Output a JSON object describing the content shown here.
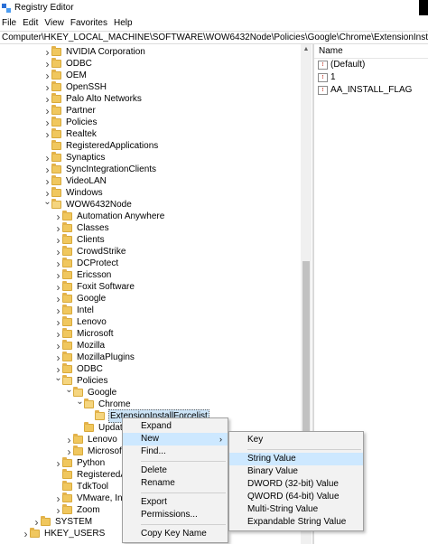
{
  "window": {
    "title": "Registry Editor"
  },
  "menu": [
    "File",
    "Edit",
    "View",
    "Favorites",
    "Help"
  ],
  "address": "Computer\\HKEY_LOCAL_MACHINE\\SOFTWARE\\WOW6432Node\\Policies\\Google\\Chrome\\ExtensionInstallForcelist",
  "tree": [
    {
      "label": "NVIDIA Corporation",
      "level": 1,
      "state": "collapsed"
    },
    {
      "label": "ODBC",
      "level": 1,
      "state": "collapsed"
    },
    {
      "label": "OEM",
      "level": 1,
      "state": "collapsed"
    },
    {
      "label": "OpenSSH",
      "level": 1,
      "state": "collapsed"
    },
    {
      "label": "Palo Alto Networks",
      "level": 1,
      "state": "collapsed"
    },
    {
      "label": "Partner",
      "level": 1,
      "state": "collapsed"
    },
    {
      "label": "Policies",
      "level": 1,
      "state": "collapsed"
    },
    {
      "label": "Realtek",
      "level": 1,
      "state": "collapsed"
    },
    {
      "label": "RegisteredApplications",
      "level": 1,
      "state": "leaf"
    },
    {
      "label": "Synaptics",
      "level": 1,
      "state": "collapsed"
    },
    {
      "label": "SyncIntegrationClients",
      "level": 1,
      "state": "collapsed"
    },
    {
      "label": "VideoLAN",
      "level": 1,
      "state": "collapsed"
    },
    {
      "label": "Windows",
      "level": 1,
      "state": "collapsed"
    },
    {
      "label": "WOW6432Node",
      "level": 1,
      "state": "expanded"
    },
    {
      "label": "Automation Anywhere",
      "level": 2,
      "state": "collapsed"
    },
    {
      "label": "Classes",
      "level": 2,
      "state": "collapsed"
    },
    {
      "label": "Clients",
      "level": 2,
      "state": "collapsed"
    },
    {
      "label": "CrowdStrike",
      "level": 2,
      "state": "collapsed"
    },
    {
      "label": "DCProtect",
      "level": 2,
      "state": "collapsed"
    },
    {
      "label": "Ericsson",
      "level": 2,
      "state": "collapsed"
    },
    {
      "label": "Foxit Software",
      "level": 2,
      "state": "collapsed"
    },
    {
      "label": "Google",
      "level": 2,
      "state": "collapsed"
    },
    {
      "label": "Intel",
      "level": 2,
      "state": "collapsed"
    },
    {
      "label": "Lenovo",
      "level": 2,
      "state": "collapsed"
    },
    {
      "label": "Microsoft",
      "level": 2,
      "state": "collapsed"
    },
    {
      "label": "Mozilla",
      "level": 2,
      "state": "collapsed"
    },
    {
      "label": "MozillaPlugins",
      "level": 2,
      "state": "collapsed"
    },
    {
      "label": "ODBC",
      "level": 2,
      "state": "collapsed"
    },
    {
      "label": "Policies",
      "level": 2,
      "state": "expanded"
    },
    {
      "label": "Google",
      "level": 3,
      "state": "expanded"
    },
    {
      "label": "Chrome",
      "level": 4,
      "state": "expanded"
    },
    {
      "label": "ExtensionInstallForcelist",
      "level": 5,
      "state": "selected"
    },
    {
      "label": "Update",
      "level": 4,
      "state": "leaf"
    },
    {
      "label": "Lenovo",
      "level": 3,
      "state": "collapsed"
    },
    {
      "label": "Microsoft",
      "level": 3,
      "state": "collapsed"
    },
    {
      "label": "Python",
      "level": 2,
      "state": "collapsed"
    },
    {
      "label": "RegisteredApp",
      "level": 2,
      "state": "leaf"
    },
    {
      "label": "TdkTool",
      "level": 2,
      "state": "leaf"
    },
    {
      "label": "VMware, Inc.",
      "level": 2,
      "state": "collapsed"
    },
    {
      "label": "Zoom",
      "level": 2,
      "state": "collapsed"
    },
    {
      "label": "SYSTEM",
      "level": 0,
      "state": "collapsed"
    },
    {
      "label": "HKEY_USERS",
      "level": -1,
      "state": "collapsed"
    }
  ],
  "values": {
    "header": "Name",
    "rows": [
      {
        "name": "(Default)",
        "icon": "string-value-icon"
      },
      {
        "name": "1",
        "icon": "string-value-icon"
      },
      {
        "name": "AA_INSTALL_FLAG",
        "icon": "string-value-icon"
      }
    ]
  },
  "context_menu": {
    "items": [
      {
        "label": "Expand",
        "type": "item"
      },
      {
        "label": "New",
        "type": "submenu",
        "highlighted": true
      },
      {
        "label": "Find...",
        "type": "item"
      },
      {
        "type": "separator"
      },
      {
        "label": "Delete",
        "type": "item"
      },
      {
        "label": "Rename",
        "type": "item"
      },
      {
        "type": "separator"
      },
      {
        "label": "Export",
        "type": "item"
      },
      {
        "label": "Permissions...",
        "type": "item"
      },
      {
        "type": "separator"
      },
      {
        "label": "Copy Key Name",
        "type": "item"
      }
    ],
    "submenu_arrow": "›"
  },
  "new_submenu": {
    "items": [
      {
        "label": "Key",
        "type": "item"
      },
      {
        "type": "separator"
      },
      {
        "label": "String Value",
        "type": "item",
        "highlighted": true
      },
      {
        "label": "Binary Value",
        "type": "item"
      },
      {
        "label": "DWORD (32-bit) Value",
        "type": "item"
      },
      {
        "label": "QWORD (64-bit) Value",
        "type": "item"
      },
      {
        "label": "Multi-String Value",
        "type": "item"
      },
      {
        "label": "Expandable String Value",
        "type": "item"
      }
    ]
  },
  "icons": {
    "folder": "folder-icon",
    "app": "registry-editor-icon",
    "value": "string-value-icon"
  },
  "colors": {
    "selection": "#cce4f7",
    "menu_highlight": "#cde8ff",
    "folder": "#f0c75e"
  }
}
